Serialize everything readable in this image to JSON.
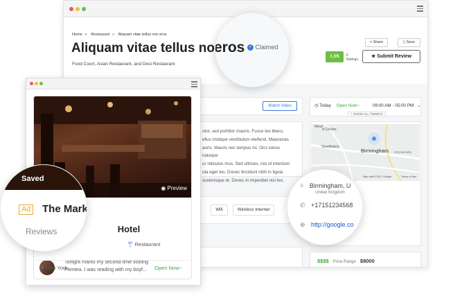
{
  "colors": {
    "accent": "#3a7bd5",
    "green": "#3caa3c",
    "rating_bg": "#6cbf43",
    "ad_orange": "#f0a830",
    "dot_red": "#ee5a52",
    "dot_yellow": "#f6bd3b",
    "dot_green": "#5fc454"
  },
  "listing": {
    "breadcrumb": [
      "Home",
      "Restaurant",
      "Aliquam vitae tellus non eros"
    ],
    "title_main": "Aliquam vitae tellus non",
    "title_zoom": "eros",
    "claimed": "Claimed",
    "categories": "Food Court, Asian Restaurant, and Desi Restaurant",
    "share": "Share",
    "save": "Save",
    "rating": "1.3/5",
    "ratings_count": "6",
    "ratings_label": "Ratings",
    "submit_review": "Submit Review",
    "watch_video": "Watch Video",
    "description": [
      "otor, sed porttitor mauris. Fusce leo libero,",
      "ellus tristique vestibulum eleifend. Maecenas",
      "auris. Mauris nec tempus mi. Orci varius natoque",
      "ur ridiculus mus. Sed ultrices, nisi id interdum",
      "ula eget leo. Donec tincidunt nibh in ligula",
      "scelerisque et. Donec in imperdiet nisi leo."
    ],
    "amenities": [
      "Wifi",
      "Wireless Internet"
    ],
    "today_label": "Today",
    "open_now": "Open Now~",
    "hours": "09:00 AM - 05:00 PM",
    "show_all": "+ SHOW ALL TIMINGS",
    "map_labels": {
      "city": "Birmingham",
      "smethwick": "Smethwick",
      "west": "West",
      "stechford": "STECHFORD",
      "copyright": "Map data ©2017 Google",
      "terms": "Terms of Use",
      "rd": "d Circles"
    },
    "address": "Birmingham, U",
    "address_sub": "United Kingdom",
    "phone": "+17151234568",
    "website": "http://google.co",
    "price_symbols": "$$$$",
    "price_range_label": "Price Range",
    "price_value": "$8000"
  },
  "card": {
    "saved": "Saved",
    "ad_badge": "Ad",
    "hotel_name": "The Mark Hotel",
    "category": "Restaurant",
    "reviews_label": "Reviews",
    "preview": "Preview",
    "review_text": [
      "Tonight marks my second time visiting",
      "Plentea. I was reading with my boyf..."
    ],
    "location": "New York",
    "open_now": "Open Now~"
  }
}
